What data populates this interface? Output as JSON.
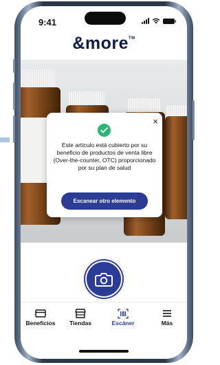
{
  "status_bar": {
    "time": "9:41"
  },
  "brand": {
    "logo_text": "&more",
    "trademark": "TM"
  },
  "dialog": {
    "close_symbol": "×",
    "icon": "check-circle-icon",
    "message": "Este artículo está cubierto por su beneficio de productos de venta libre (Over-the-counter, OTC) proporcionado por su plan de salud",
    "button_label": "Escanear otro elemento"
  },
  "camera": {
    "icon": "camera-icon"
  },
  "tabs": [
    {
      "label": "Beneficios",
      "icon": "card-icon",
      "active": false
    },
    {
      "label": "Tiendas",
      "icon": "store-icon",
      "active": false
    },
    {
      "label": "Escáner",
      "icon": "barcode-scan-icon",
      "active": true
    },
    {
      "label": "Más",
      "icon": "menu-icon",
      "active": false
    }
  ],
  "colors": {
    "brand_blue": "#2b3c97",
    "success_green": "#2bb673",
    "logo_navy": "#121b45"
  }
}
